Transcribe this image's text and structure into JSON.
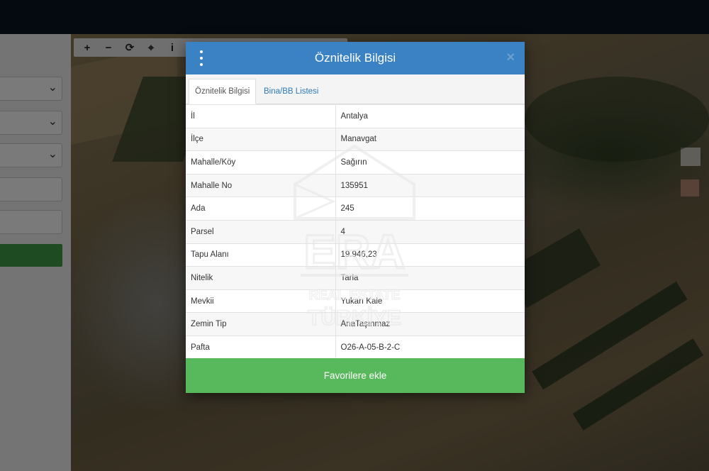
{
  "map_toolbar": {
    "zoom_in": "+",
    "zoom_out": "−",
    "refresh": "⟳",
    "locate": "⌖",
    "info": "i"
  },
  "modal": {
    "title": "Öznitelik Bilgisi",
    "close": "×",
    "tabs": [
      {
        "label": "Öznitelik Bilgisi",
        "active": true
      },
      {
        "label": "Bina/BB Listesi",
        "active": false
      }
    ],
    "rows": [
      {
        "key": "İl",
        "value": "Antalya"
      },
      {
        "key": "İlçe",
        "value": "Manavgat"
      },
      {
        "key": "Mahalle/Köy",
        "value": "Sağırın"
      },
      {
        "key": "Mahalle No",
        "value": "135951"
      },
      {
        "key": "Ada",
        "value": "245"
      },
      {
        "key": "Parsel",
        "value": "4"
      },
      {
        "key": "Tapu Alanı",
        "value": "19.946,23"
      },
      {
        "key": "Nitelik",
        "value": "Tarla"
      },
      {
        "key": "Mevkii",
        "value": "Yukarı Kale"
      },
      {
        "key": "Zemin Tip",
        "value": "AnaTaşınmaz"
      },
      {
        "key": "Pafta",
        "value": "O26-A-05-B-2-C"
      }
    ],
    "favorite_label": "Favorilere ekle"
  },
  "watermark": {
    "brand": "ERA",
    "line1": "REAL ESTATE",
    "line2": "TÜRKİYE"
  },
  "colors": {
    "header_blue": "#3a82c4",
    "button_green": "#58b85c",
    "left_green": "#3f9e48"
  }
}
